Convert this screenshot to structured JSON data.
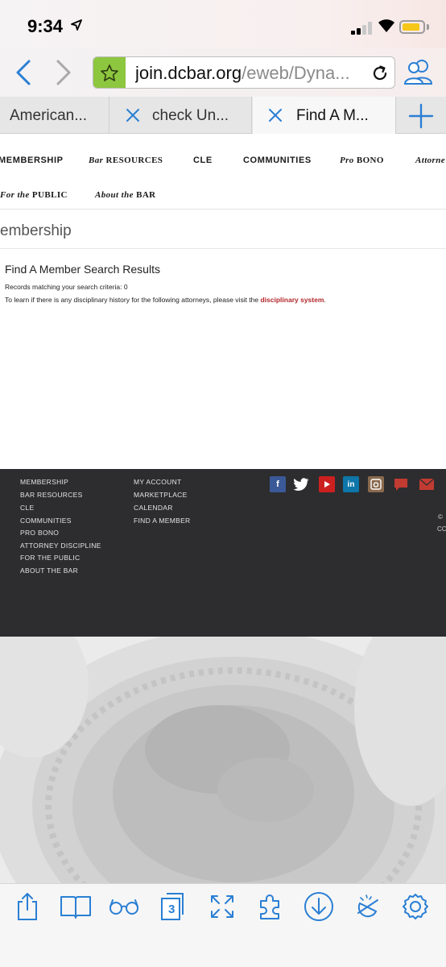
{
  "status_bar": {
    "time": "9:34"
  },
  "browser": {
    "url_domain": "join.dcbar.org",
    "url_path": "/eweb/Dyna...",
    "tabs": [
      {
        "label": "American..."
      },
      {
        "label": "check Un..."
      },
      {
        "label": "Find A M..."
      }
    ]
  },
  "site_nav": {
    "items": [
      {
        "label": "MEMBERSHIP"
      },
      {
        "label_italic": "Bar",
        "label": "RESOURCES"
      },
      {
        "label": "CLE"
      },
      {
        "label": "COMMUNITIES"
      },
      {
        "label_italic": "Pro",
        "label": "BONO"
      },
      {
        "label_italic": "Attorne"
      },
      {
        "label_italic": "For the",
        "label": "PUBLIC"
      },
      {
        "label_italic": "About the",
        "label": "BAR"
      }
    ]
  },
  "page": {
    "section_title": "embership",
    "result_heading": "Find A Member Search Results",
    "records_text": "Records matching your search criteria: 0",
    "discipline_prefix": "To learn if there is any disciplinary history for the following attorneys, please visit the ",
    "discipline_link": "disciplinary system",
    "discipline_suffix": "."
  },
  "footer": {
    "col1": [
      "MEMBERSHIP",
      "BAR RESOURCES",
      "CLE",
      "COMMUNITIES",
      "PRO BONO",
      "ATTORNEY DISCIPLINE",
      "FOR THE PUBLIC",
      "ABOUT THE BAR"
    ],
    "col2": [
      "MY ACCOUNT",
      "MARKETPLACE",
      "CALENDAR",
      "FIND A MEMBER"
    ],
    "social_icons": [
      "facebook-icon",
      "twitter-icon",
      "youtube-icon",
      "linkedin-icon",
      "instagram-icon",
      "chat-icon",
      "email-icon"
    ],
    "edge_text": [
      "©",
      "CC"
    ]
  },
  "bottom_bar": {
    "tab_count": "3"
  },
  "colors": {
    "accent": "#2a7fd4",
    "link_red": "#b3262a",
    "footer_bg": "#2d2d2f",
    "star_green": "#8dc63f"
  }
}
